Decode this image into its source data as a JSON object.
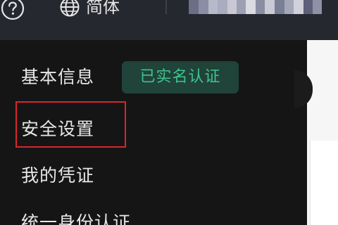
{
  "topbar": {
    "help_icon": "question-circle-icon",
    "language": {
      "icon": "globe-icon",
      "label": "简体"
    },
    "user_avatar_pixelated": true
  },
  "menu": {
    "items": [
      {
        "label": "基本信息",
        "badge": "已实名认证"
      },
      {
        "label": "安全设置",
        "highlighted": true
      },
      {
        "label": "我的凭证"
      },
      {
        "label": "统一身份认证"
      }
    ]
  },
  "colors": {
    "topbar_bg": "#262830",
    "menu_bg": "#151516",
    "menu_text": "#e8e8e8",
    "badge_bg": "#20433a",
    "badge_text": "#3fc48e",
    "highlight_border": "#d8262c",
    "page_bg": "#f6f6f7"
  }
}
